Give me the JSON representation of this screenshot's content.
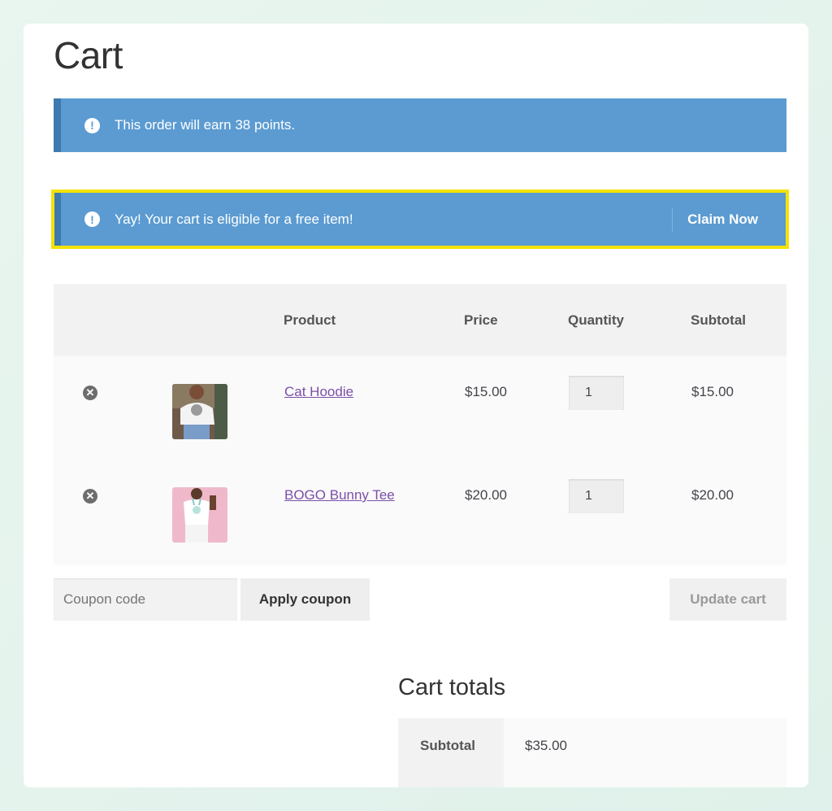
{
  "page": {
    "title": "Cart"
  },
  "notices": {
    "points": {
      "text": "This order will earn 38 points."
    },
    "free_item": {
      "text": "Yay! Your cart is eligible for a free item!",
      "action_label": "Claim Now"
    }
  },
  "cart_table": {
    "headers": {
      "product": "Product",
      "price": "Price",
      "quantity": "Quantity",
      "subtotal": "Subtotal"
    },
    "rows": [
      {
        "name": "Cat Hoodie",
        "price": "$15.00",
        "quantity": "1",
        "subtotal": "$15.00"
      },
      {
        "name": "BOGO Bunny Tee",
        "price": "$20.00",
        "quantity": "1",
        "subtotal": "$20.00"
      }
    ]
  },
  "actions": {
    "coupon_placeholder": "Coupon code",
    "apply_coupon_label": "Apply coupon",
    "update_cart_label": "Update cart"
  },
  "totals": {
    "title": "Cart totals",
    "subtotal_label": "Subtotal",
    "subtotal_value": "$35.00"
  },
  "colors": {
    "notice_bg": "#5b9bd1",
    "highlight_border": "#f5e200",
    "link": "#7b4fa8"
  }
}
